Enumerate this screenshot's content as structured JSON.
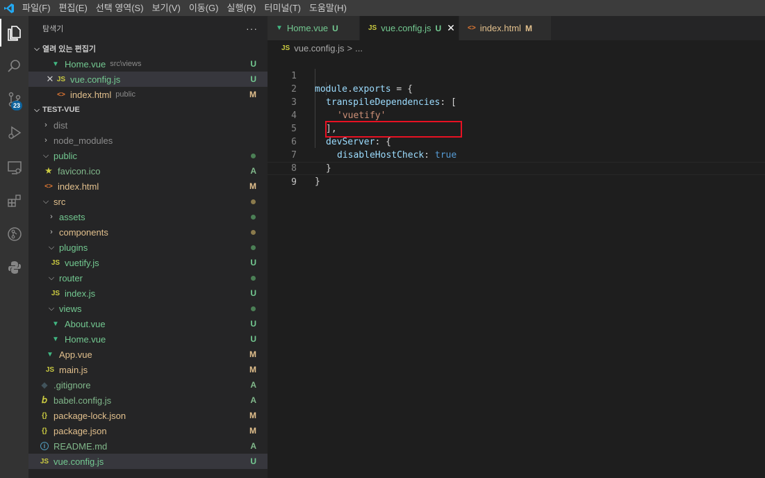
{
  "menu": {
    "items": [
      "파일(F)",
      "편집(E)",
      "선택 영역(S)",
      "보기(V)",
      "이동(G)",
      "실행(R)",
      "터미널(T)",
      "도움말(H)"
    ]
  },
  "activity": {
    "scm_badge": "23"
  },
  "sidebar": {
    "title": "탐색기",
    "more": "···",
    "open_editors": {
      "header": "열려 있는 편집기",
      "items": [
        {
          "name": "Home.vue",
          "desc": "src\\views",
          "status": "U"
        },
        {
          "name": "vue.config.js",
          "desc": "",
          "status": "U",
          "close": "✕"
        },
        {
          "name": "index.html",
          "desc": "public",
          "status": "M"
        }
      ]
    },
    "project": {
      "header": "TEST-VUE",
      "items": [
        {
          "name": "dist",
          "status": ""
        },
        {
          "name": "node_modules",
          "status": ""
        },
        {
          "name": "public",
          "status": ""
        },
        {
          "name": "favicon.ico",
          "status": "A"
        },
        {
          "name": "index.html",
          "status": "M"
        },
        {
          "name": "src",
          "status": ""
        },
        {
          "name": "assets",
          "status": ""
        },
        {
          "name": "components",
          "status": ""
        },
        {
          "name": "plugins",
          "status": ""
        },
        {
          "name": "vuetify.js",
          "status": "U"
        },
        {
          "name": "router",
          "status": ""
        },
        {
          "name": "index.js",
          "status": "U"
        },
        {
          "name": "views",
          "status": ""
        },
        {
          "name": "About.vue",
          "status": "U"
        },
        {
          "name": "Home.vue",
          "status": "U"
        },
        {
          "name": "App.vue",
          "status": "M"
        },
        {
          "name": "main.js",
          "status": "M"
        },
        {
          "name": ".gitignore",
          "status": "A"
        },
        {
          "name": "babel.config.js",
          "status": "A"
        },
        {
          "name": "package-lock.json",
          "status": "M"
        },
        {
          "name": "package.json",
          "status": "M"
        },
        {
          "name": "README.md",
          "status": "A"
        },
        {
          "name": "vue.config.js",
          "status": "U"
        }
      ]
    }
  },
  "tabs": [
    {
      "label": "Home.vue",
      "status": "U"
    },
    {
      "label": "vue.config.js",
      "status": "U",
      "close": "✕"
    },
    {
      "label": "index.html",
      "status": "M"
    }
  ],
  "breadcrumb": {
    "file": "vue.config.js",
    "sep": ">",
    "rest": "..."
  },
  "icons": {
    "js": "JS",
    "html": "<>",
    "vue": "vue-icon",
    "json": "{}",
    "info": "i"
  },
  "colors": {
    "untracked": "#73c991",
    "modified": "#e2c08d",
    "added": "#81b88b",
    "highlight": "#e81123"
  },
  "editor": {
    "line_numbers": [
      "1",
      "2",
      "3",
      "4",
      "5",
      "6",
      "7",
      "8",
      "9"
    ],
    "lines": {
      "l1": {
        "a": "module",
        "b": ".",
        "c": "exports",
        "d": " = {"
      },
      "l2": {
        "a": "transpileDependencies",
        "b": ": ["
      },
      "l3": {
        "a": "'vuetify'"
      },
      "l4": {
        "a": "],"
      },
      "l5": {
        "a": "devServer",
        "b": ": {"
      },
      "l6": {
        "a": "disableHostCheck",
        "b": ": ",
        "c": "true"
      },
      "l7": {
        "a": "}"
      },
      "l8": {
        "a": "}"
      }
    }
  }
}
